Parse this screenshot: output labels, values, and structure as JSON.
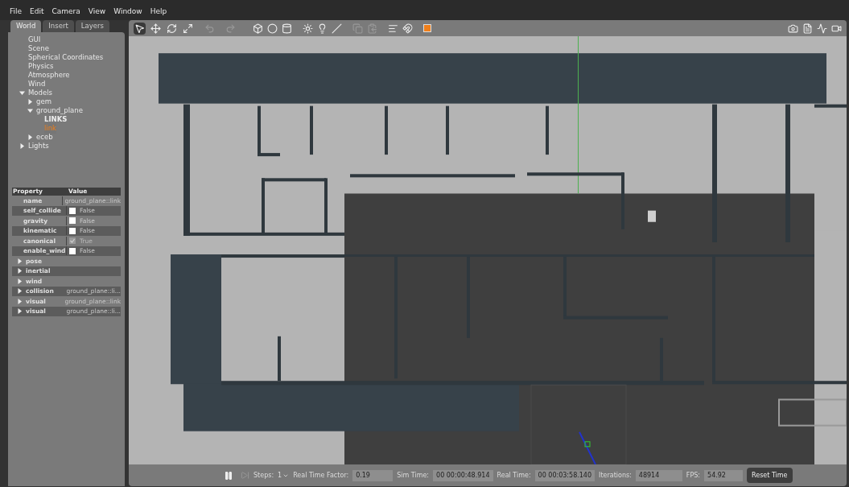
{
  "menu": [
    "File",
    "Edit",
    "Camera",
    "View",
    "Window",
    "Help"
  ],
  "tabs": [
    {
      "label": "World",
      "selected": true
    },
    {
      "label": "Insert",
      "selected": false
    },
    {
      "label": "Layers",
      "selected": false
    }
  ],
  "tree": [
    {
      "label": "GUI",
      "kind": "leaf",
      "selected": false
    },
    {
      "label": "Scene",
      "kind": "leaf",
      "selected": false
    },
    {
      "label": "Spherical Coordinates",
      "kind": "leaf",
      "selected": false
    },
    {
      "label": "Physics",
      "kind": "leaf",
      "selected": false
    },
    {
      "label": "Atmosphere",
      "kind": "leaf",
      "selected": false
    },
    {
      "label": "Wind",
      "kind": "leaf",
      "selected": false
    },
    {
      "label": "Models",
      "kind": "branch",
      "expanded": true,
      "selected": false,
      "children": [
        {
          "label": "gem",
          "kind": "branch",
          "expanded": false,
          "selected": false
        },
        {
          "label": "ground_plane",
          "kind": "branch",
          "expanded": true,
          "selected": false,
          "children": [
            {
              "label": "LINKS",
              "kind": "header"
            },
            {
              "label": "link",
              "kind": "leaf",
              "selected": true
            }
          ]
        },
        {
          "label": "eceb",
          "kind": "branch",
          "expanded": false,
          "selected": false
        }
      ]
    },
    {
      "label": "Lights",
      "kind": "branch",
      "expanded": false,
      "selected": false
    }
  ],
  "properties": {
    "columns": [
      "Property",
      "Value"
    ],
    "rows": [
      {
        "kind": "text",
        "name": "name",
        "value": "ground_plane::link"
      },
      {
        "kind": "checkbox",
        "name": "self_collide",
        "checked": false,
        "disabled": false,
        "value": "False"
      },
      {
        "kind": "checkbox",
        "name": "gravity",
        "checked": false,
        "disabled": false,
        "value": "False"
      },
      {
        "kind": "checkbox",
        "name": "kinematic",
        "checked": false,
        "disabled": false,
        "value": "False"
      },
      {
        "kind": "checkbox",
        "name": "canonical",
        "checked": true,
        "disabled": true,
        "value": "True"
      },
      {
        "kind": "checkbox",
        "name": "enable_wind",
        "checked": false,
        "disabled": false,
        "value": "False"
      },
      {
        "kind": "group",
        "name": "pose",
        "expanded": false
      },
      {
        "kind": "group",
        "name": "inertial",
        "expanded": false
      },
      {
        "kind": "group",
        "name": "wind",
        "expanded": false
      },
      {
        "kind": "group",
        "name": "collision",
        "expanded": false,
        "value": "ground_plane::li..."
      },
      {
        "kind": "group",
        "name": "visual",
        "expanded": false,
        "value": "ground_plane::link"
      },
      {
        "kind": "group",
        "name": "visual",
        "expanded": false,
        "value": "ground_plane::li..."
      }
    ]
  },
  "toolbar": [
    {
      "kind": "select",
      "selected": true
    },
    {
      "kind": "translate",
      "selected": false
    },
    {
      "kind": "rotate",
      "selected": false
    },
    {
      "kind": "scale",
      "selected": false
    }
  ],
  "status_bar": {
    "steps_label": "Steps:",
    "steps": "1",
    "rtf_label": "Real Time Factor:",
    "rtf": "0.19",
    "sim_label": "Sim Time:",
    "sim": "00 00:00:48.914",
    "real_label": "Real Time:",
    "real": "00 00:03:58.140",
    "iter_label": "Iterations:",
    "iter": "48914",
    "fps_label": "FPS:",
    "fps": "54.92",
    "reset": "Reset Time"
  }
}
